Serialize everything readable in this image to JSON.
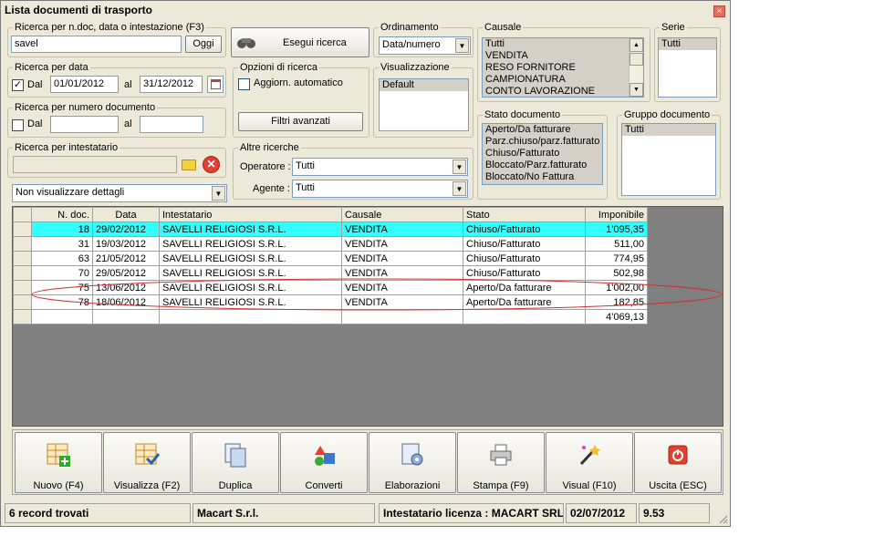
{
  "window": {
    "title": "Lista documenti di trasporto",
    "close": "×"
  },
  "search_doc": {
    "legend": "Ricerca per n.doc, data o intestazione (F3)",
    "value": "savel",
    "today_button": "Oggi"
  },
  "execute_button": "Esegui ricerca",
  "ordering": {
    "legend": "Ordinamento",
    "value": "Data/numero"
  },
  "causale": {
    "legend": "Causale",
    "items": [
      "Tutti",
      "VENDITA",
      "RESO FORNITORE",
      "CAMPIONATURA",
      "CONTO LAVORAZIONE"
    ]
  },
  "serie": {
    "legend": "Serie",
    "items": [
      "Tutti"
    ]
  },
  "date_search": {
    "legend": "Ricerca per data",
    "from_label": "Dal",
    "from_value": "01/01/2012",
    "to_label": "al",
    "to_value": "31/12/2012",
    "checked_mark": "✓"
  },
  "number_search": {
    "legend": "Ricerca per numero documento",
    "from_label": "Dal",
    "to_label": "al"
  },
  "options": {
    "legend": "Opzioni di ricerca",
    "auto_update": "Aggiorn. automatico",
    "advanced_filters": "Filtri avanzati"
  },
  "visualization": {
    "legend": "Visualizzazione",
    "items": [
      "Default"
    ]
  },
  "doc_state": {
    "legend": "Stato documento",
    "items": [
      "Aperto/Da fatturare",
      "Parz.chiuso/parz.fatturato",
      "Chiuso/Fatturato",
      "Bloccato/Parz.fatturato",
      "Bloccato/No Fattura"
    ]
  },
  "doc_group": {
    "legend": "Gruppo documento",
    "items": [
      "Tutti"
    ]
  },
  "holder_search": {
    "legend": "Ricerca per intestatario"
  },
  "other_searches": {
    "legend": "Altre ricerche",
    "operator_label": "Operatore :",
    "operator_value": "Tutti",
    "agent_label": "Agente :",
    "agent_value": "Tutti"
  },
  "details_select": "Non visualizzare dettagli",
  "table": {
    "headers": [
      "N. doc.",
      "Data",
      "Intestatario",
      "Causale",
      "Stato",
      "Imponibile"
    ],
    "rows": [
      [
        "18",
        "29/02/2012",
        "SAVELLI RELIGIOSI S.R.L.",
        "VENDITA",
        "Chiuso/Fatturato",
        "1'095,35"
      ],
      [
        "31",
        "19/03/2012",
        "SAVELLI RELIGIOSI S.R.L.",
        "VENDITA",
        "Chiuso/Fatturato",
        "511,00"
      ],
      [
        "63",
        "21/05/2012",
        "SAVELLI RELIGIOSI S.R.L.",
        "VENDITA",
        "Chiuso/Fatturato",
        "774,95"
      ],
      [
        "70",
        "29/05/2012",
        "SAVELLI RELIGIOSI S.R.L.",
        "VENDITA",
        "Chiuso/Fatturato",
        "502,98"
      ],
      [
        "75",
        "13/06/2012",
        "SAVELLI RELIGIOSI S.R.L.",
        "VENDITA",
        "Aperto/Da fatturare",
        "1'002,00"
      ],
      [
        "78",
        "18/06/2012",
        "SAVELLI RELIGIOSI S.R.L.",
        "VENDITA",
        "Aperto/Da fatturare",
        "182,85"
      ]
    ],
    "total": "4'069,13",
    "highlight_color": "#33ffff"
  },
  "toolbar": [
    {
      "label": "Nuovo (F4)",
      "icon": "new-doc-icon"
    },
    {
      "label": "Visualizza (F2)",
      "icon": "view-icon"
    },
    {
      "label": "Duplica",
      "icon": "duplicate-icon"
    },
    {
      "label": "Converti",
      "icon": "convert-icon"
    },
    {
      "label": "Elaborazioni",
      "icon": "process-icon"
    },
    {
      "label": "Stampa (F9)",
      "icon": "printer-icon"
    },
    {
      "label": "Visual (F10)",
      "icon": "magic-wand-icon"
    },
    {
      "label": "Uscita (ESC)",
      "icon": "power-icon"
    }
  ],
  "status": {
    "records": "6 record trovati",
    "company": "Macart S.r.l.",
    "license": "Intestatario licenza : MACART SRL",
    "date": "02/07/2012",
    "version": "9.53"
  }
}
